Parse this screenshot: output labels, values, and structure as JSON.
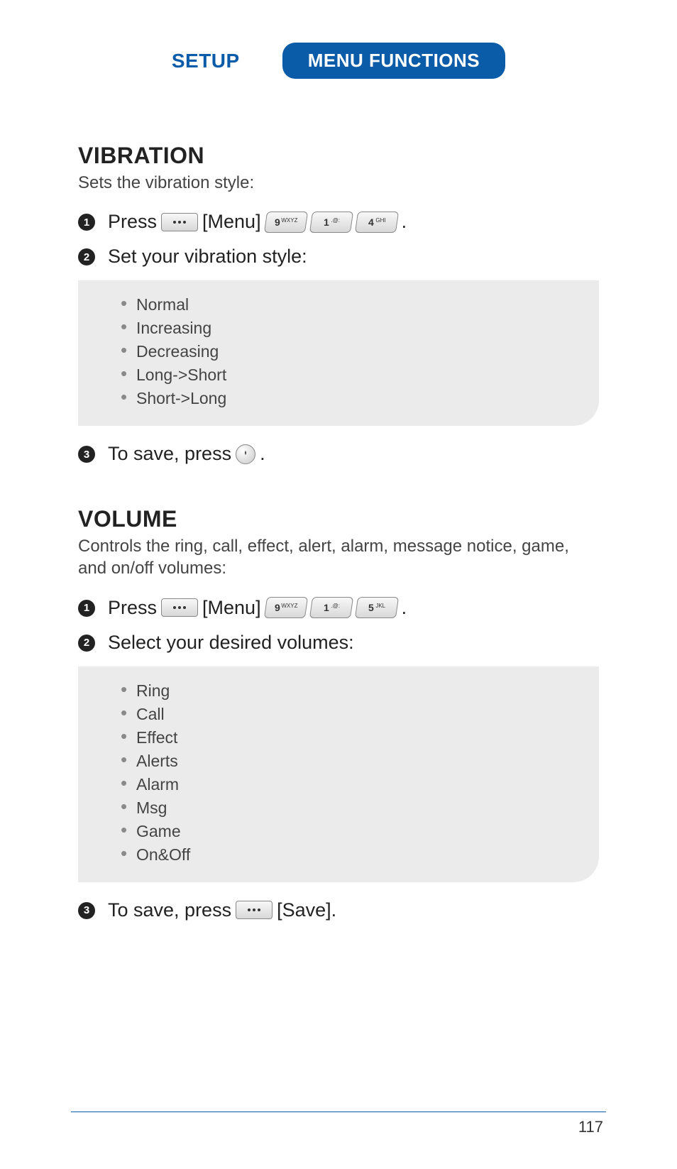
{
  "header": {
    "setup": "SETUP",
    "menu_functions": "MENU FUNCTIONS"
  },
  "vibration": {
    "title": "VIBRATION",
    "subtitle": "Sets the vibration style:",
    "steps": {
      "s1_press": "Press",
      "s1_menu": "[Menu]",
      "s1_key1_num": "9",
      "s1_key1_lbl": "WXYZ",
      "s1_key2_num": "1",
      "s1_key2_lbl": ".@:",
      "s1_key3_num": "4",
      "s1_key3_lbl": "GHI",
      "s1_dot": ".",
      "s2": "Set your vibration style:",
      "opts": [
        "Normal",
        "Increasing",
        "Decreasing",
        "Long->Short",
        "Short->Long"
      ],
      "s3_a": "To save, press",
      "s3_b": "."
    }
  },
  "volume": {
    "title": "VOLUME",
    "subtitle": "Controls the ring, call, effect, alert, alarm, message notice, game, and on/off volumes:",
    "steps": {
      "s1_press": "Press",
      "s1_menu": "[Menu]",
      "s1_key1_num": "9",
      "s1_key1_lbl": "WXYZ",
      "s1_key2_num": "1",
      "s1_key2_lbl": ".@:",
      "s1_key3_num": "5",
      "s1_key3_lbl": "JKL",
      "s1_dot": ".",
      "s2": "Select your desired volumes:",
      "opts": [
        "Ring",
        "Call",
        "Effect",
        "Alerts",
        "Alarm",
        "Msg",
        "Game",
        "On&Off"
      ],
      "s3_a": "To save, press",
      "s3_save": "[Save].",
      "s3_b": ""
    }
  },
  "page": "117"
}
